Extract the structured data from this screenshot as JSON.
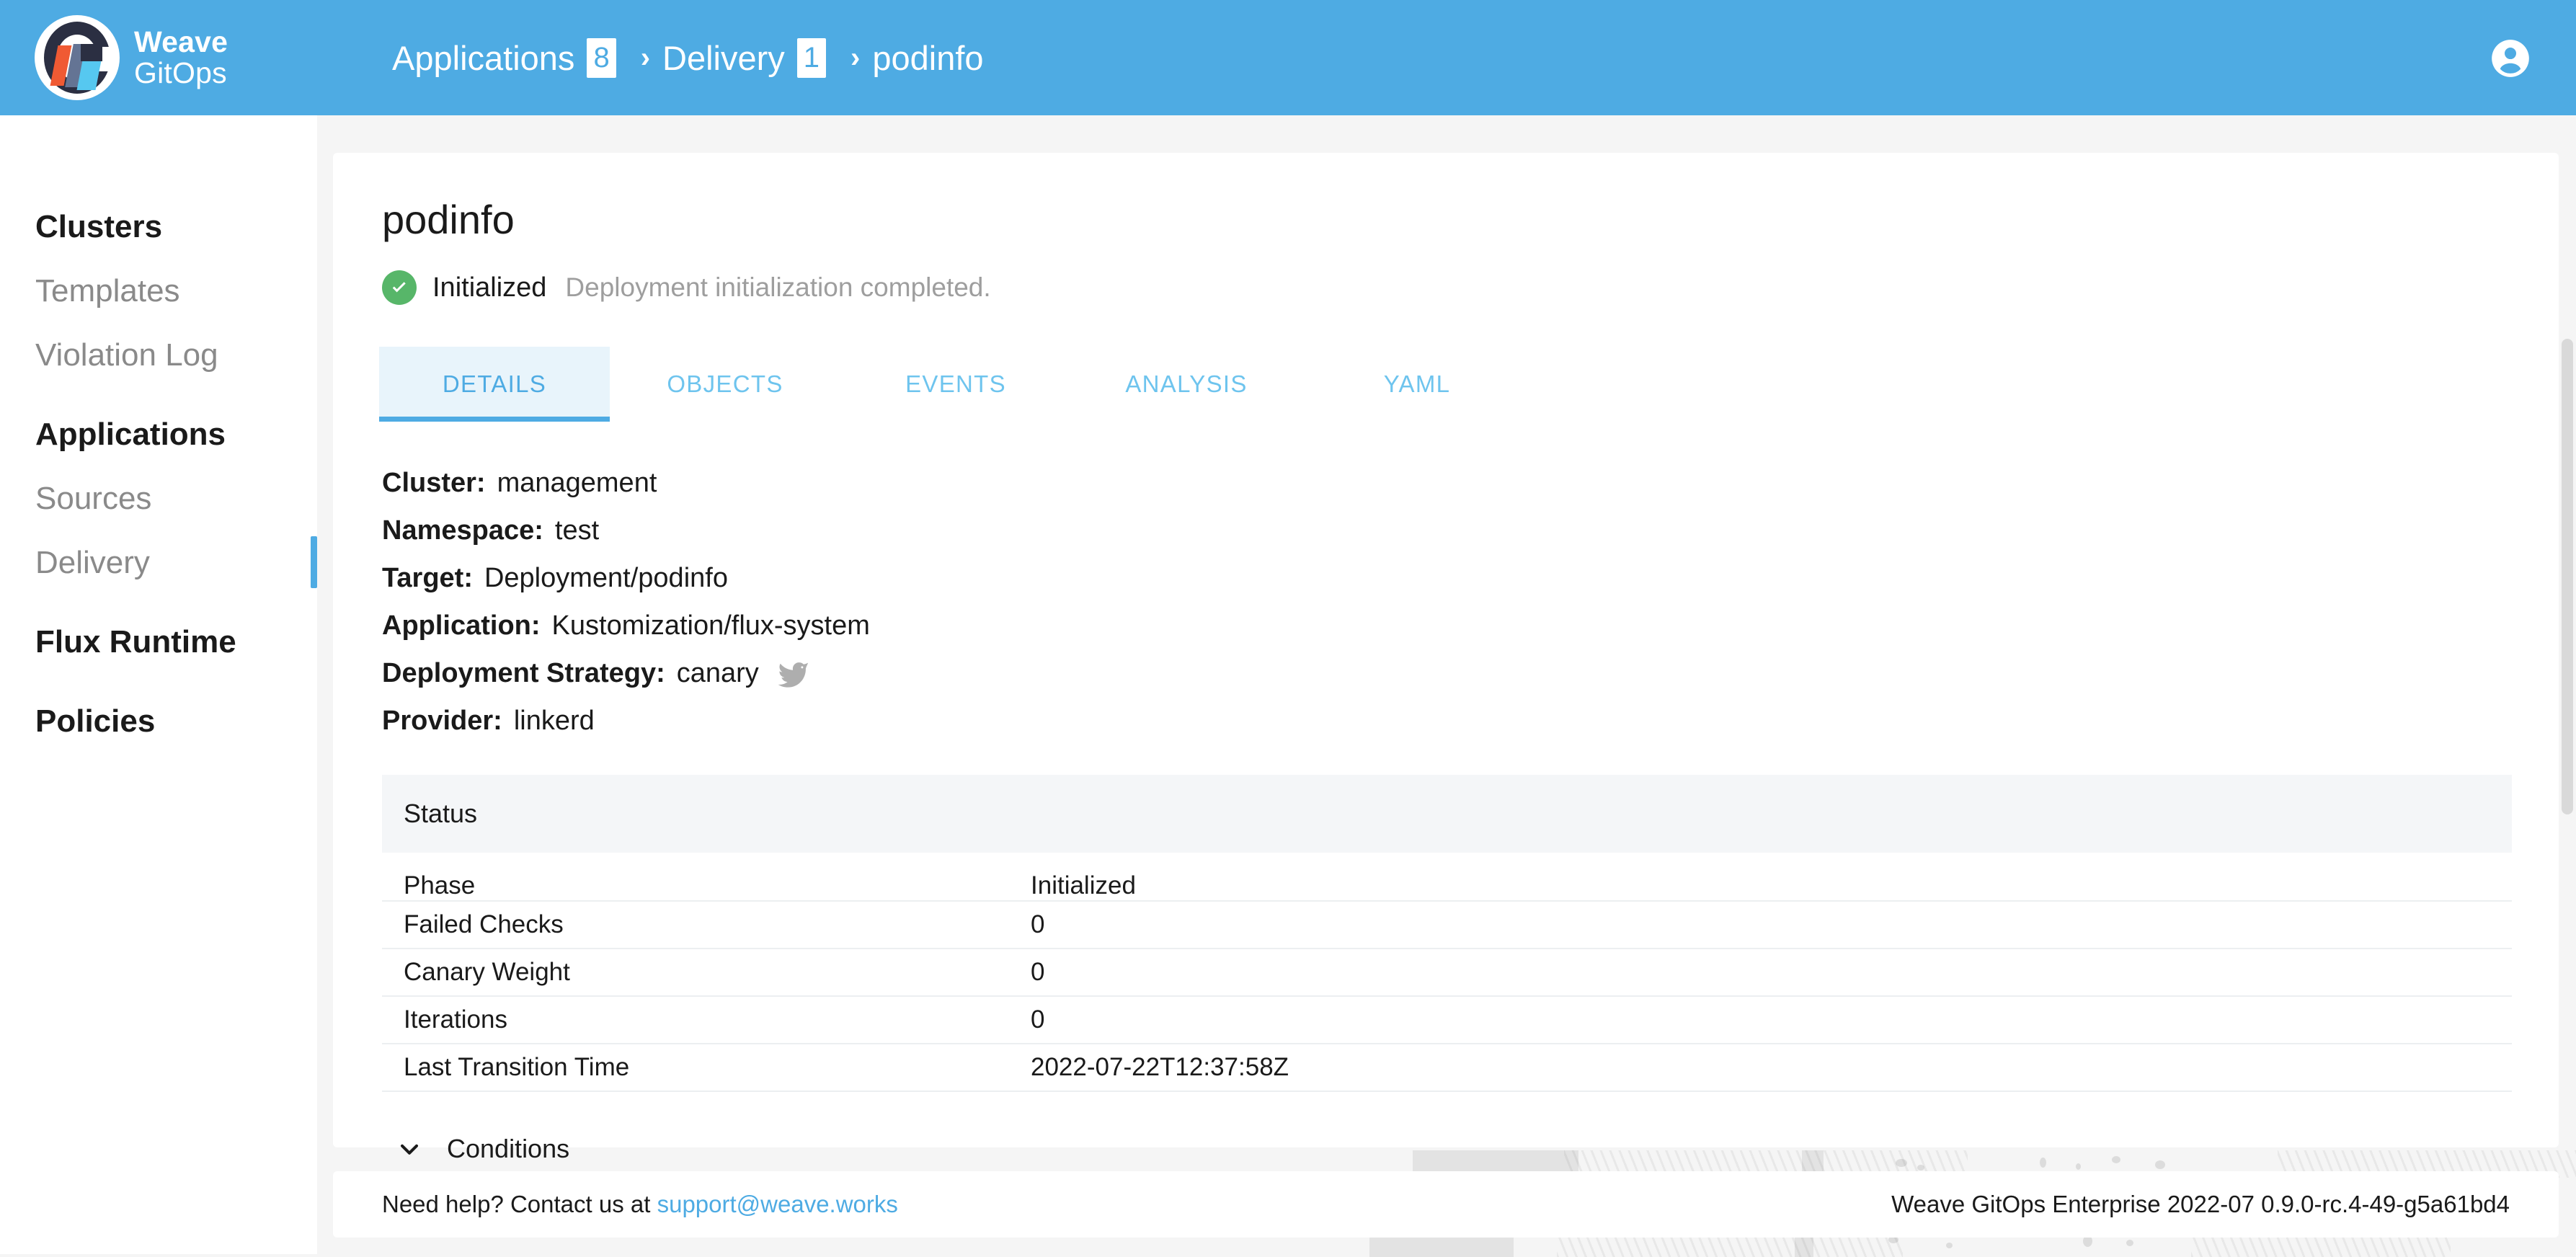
{
  "brand": {
    "line1": "Weave",
    "line2": "GitOps",
    "logo_icon": "weave-gitops-logo",
    "colors": {
      "header_blue": "#4eabe3",
      "logo_dark": "#2b2f42",
      "logo_orange": "#f05a33",
      "logo_slate": "#647494",
      "logo_cyan": "#56c8f0"
    }
  },
  "header": {
    "breadcrumb": [
      {
        "label": "Applications",
        "badge": "8"
      },
      {
        "label": "Delivery",
        "badge": "1"
      },
      {
        "label": "podinfo",
        "badge": ""
      }
    ],
    "separator": "›",
    "account_icon": "account-circle-icon"
  },
  "sidebar": {
    "items": [
      {
        "label": "Clusters",
        "type": "section",
        "active": false
      },
      {
        "label": "Templates",
        "type": "link",
        "active": false
      },
      {
        "label": "Violation Log",
        "type": "link",
        "active": false
      },
      {
        "label": "Applications",
        "type": "section",
        "active": false
      },
      {
        "label": "Sources",
        "type": "link",
        "active": false
      },
      {
        "label": "Delivery",
        "type": "link",
        "active": true
      },
      {
        "label": "Flux Runtime",
        "type": "section",
        "active": false
      },
      {
        "label": "Policies",
        "type": "section",
        "active": false
      }
    ],
    "active_color": "#4eabe3"
  },
  "main": {
    "title": "podinfo",
    "status": {
      "icon": "check-circle-icon",
      "icon_color": "#57b669",
      "label": "Initialized",
      "description": "Deployment initialization completed."
    },
    "tabs": [
      {
        "label": "DETAILS",
        "active": true
      },
      {
        "label": "OBJECTS",
        "active": false
      },
      {
        "label": "EVENTS",
        "active": false
      },
      {
        "label": "ANALYSIS",
        "active": false
      },
      {
        "label": "YAML",
        "active": false
      }
    ],
    "details": [
      {
        "key": "Cluster:",
        "value": "management",
        "icon": ""
      },
      {
        "key": "Namespace:",
        "value": "test",
        "icon": ""
      },
      {
        "key": "Target:",
        "value": "Deployment/podinfo",
        "icon": ""
      },
      {
        "key": "Application:",
        "value": "Kustomization/flux-system",
        "icon": ""
      },
      {
        "key": "Deployment Strategy:",
        "value": "canary",
        "icon": "flagger-bird-icon"
      },
      {
        "key": "Provider:",
        "value": "linkerd",
        "icon": ""
      }
    ],
    "status_section": {
      "header": "Status",
      "rows": [
        {
          "key": "Phase",
          "value": "Initialized"
        },
        {
          "key": "Failed Checks",
          "value": "0"
        },
        {
          "key": "Canary Weight",
          "value": "0"
        },
        {
          "key": "Iterations",
          "value": "0"
        },
        {
          "key": "Last Transition Time",
          "value": "2022-07-22T12:37:58Z"
        }
      ]
    },
    "conditions": {
      "icon": "chevron-down-icon",
      "label": "Conditions",
      "expanded": false
    }
  },
  "footer": {
    "help_prefix": "Need help? Contact us at ",
    "support_email": "support@weave.works",
    "version": "Weave GitOps Enterprise 2022-07 0.9.0-rc.4-49-g5a61bd4"
  }
}
